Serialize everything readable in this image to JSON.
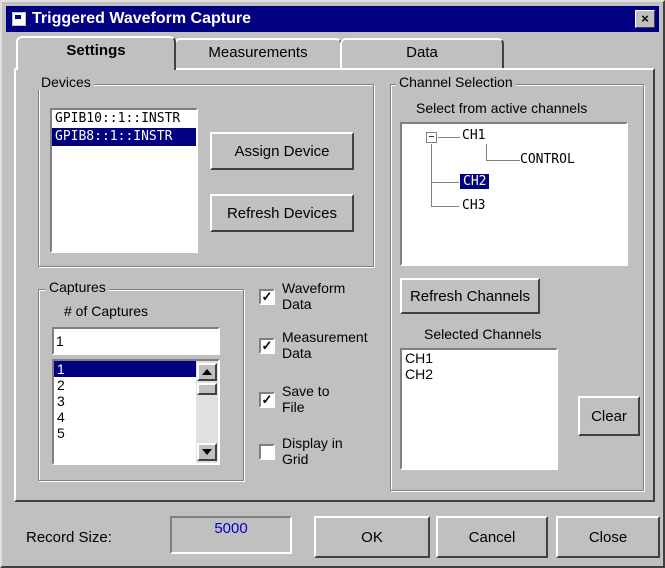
{
  "window": {
    "title": "Triggered Waveform Capture",
    "close_glyph": "×"
  },
  "tabs": [
    {
      "label": "Settings",
      "active": true
    },
    {
      "label": "Measurements",
      "active": false
    },
    {
      "label": "Data",
      "active": false
    }
  ],
  "devices": {
    "legend": "Devices",
    "items": [
      {
        "label": "GPIB10::1::INSTR",
        "selected": false
      },
      {
        "label": "GPIB8::1::INSTR",
        "selected": true
      }
    ],
    "assign_label": "Assign Device",
    "refresh_label": "Refresh Devices"
  },
  "captures": {
    "legend": "Captures",
    "count_label": "# of Captures",
    "input_value": "1",
    "list": [
      "1",
      "2",
      "3",
      "4",
      "5"
    ],
    "selected_index": 0
  },
  "options": [
    {
      "label_line1": "Waveform",
      "label_line2": "Data",
      "checked": true
    },
    {
      "label_line1": "Measurement",
      "label_line2": "Data",
      "checked": true
    },
    {
      "label_line1": "Save to",
      "label_line2": "File",
      "checked": true
    },
    {
      "label_line1": "Display in",
      "label_line2": "Grid",
      "checked": false
    }
  ],
  "channel_selection": {
    "legend": "Channel Selection",
    "subtitle": "Select from active channels",
    "tree": {
      "ch1": "CH1",
      "ch1_child": "CONTROL",
      "ch2": "CH2",
      "ch3": "CH3",
      "expander": "−",
      "selected": "CH2"
    },
    "refresh_label": "Refresh Channels",
    "selected_label": "Selected Channels",
    "selected_items": [
      "CH1",
      "CH2"
    ],
    "clear_label": "Clear"
  },
  "footer": {
    "record_size_label": "Record Size:",
    "record_size_value": "5000",
    "ok_label": "OK",
    "cancel_label": "Cancel",
    "close_label": "Close"
  },
  "colors": {
    "selection": "#000080",
    "record_value": "#0000cc",
    "face": "#c0c0c0"
  }
}
